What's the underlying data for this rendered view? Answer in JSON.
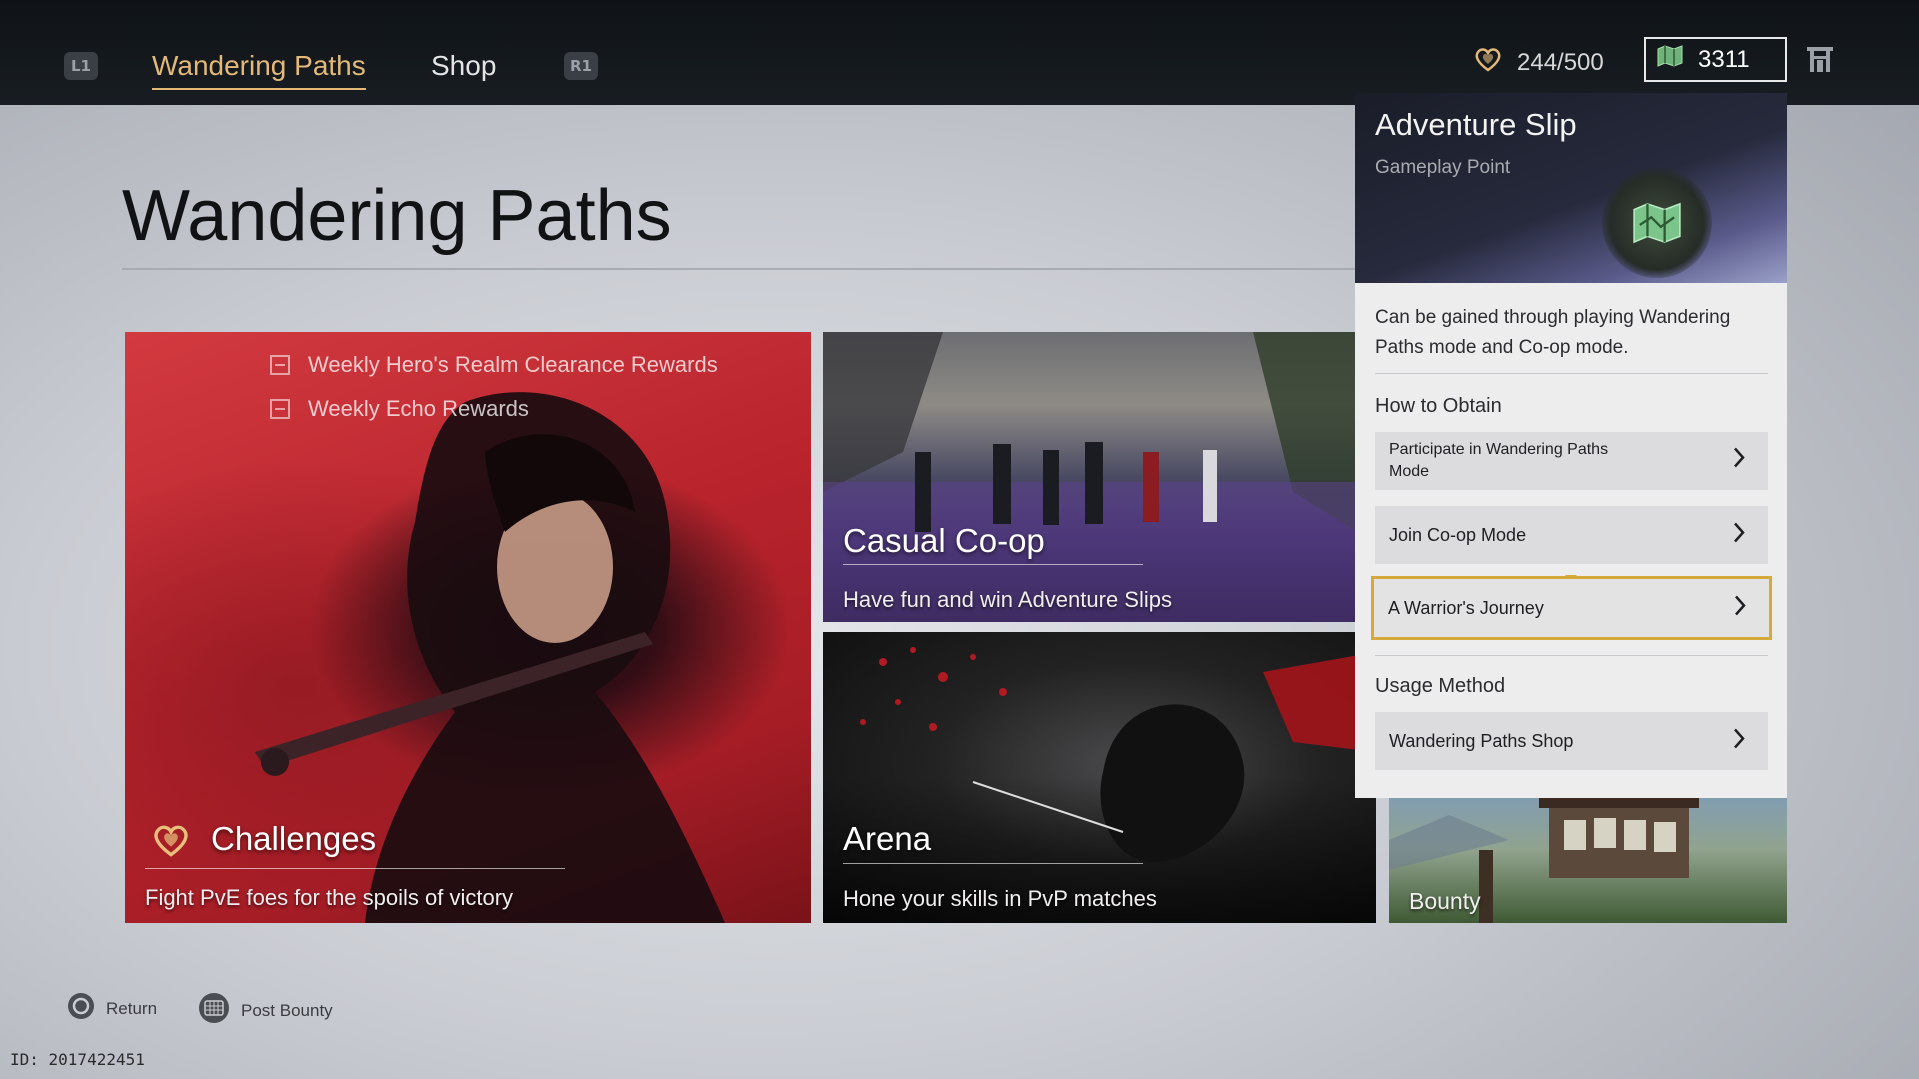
{
  "topbar": {
    "l1_hint": "L1",
    "r1_hint": "R1",
    "tabs": [
      {
        "label": "Wandering Paths",
        "active": true
      },
      {
        "label": "Shop",
        "active": false
      }
    ],
    "stamina": "244/500",
    "adventure_slips": "3311",
    "accent_color": "#e3b979"
  },
  "page": {
    "title": "Wandering Paths"
  },
  "cards": {
    "challenges": {
      "weekly_items": [
        "Weekly Hero's Realm Clearance Rewards",
        "Weekly Echo Rewards"
      ],
      "label": "Challenges",
      "desc": "Fight PvE foes for the spoils of victory"
    },
    "casual_coop": {
      "label": "Casual Co-op",
      "desc": "Have fun and win Adventure Slips"
    },
    "arena": {
      "label": "Arena",
      "desc": "Hone your skills in PvP matches"
    },
    "bounty": {
      "label": "Bounty"
    }
  },
  "tooltip": {
    "title": "Adventure Slip",
    "subtitle": "Gameplay Point",
    "description": "Can be gained through playing Wandering Paths mode and Co-op mode.",
    "how_to_obtain_label": "How to Obtain",
    "obtain_options": [
      "Participate in Wandering Paths Mode",
      "Join Co-op Mode",
      "A Warrior's Journey"
    ],
    "usage_label": "Usage Method",
    "usage_options": [
      "Wandering Paths Shop"
    ],
    "selected_color": "#d7a93a"
  },
  "footer": {
    "return_label": "Return",
    "post_bounty_label": "Post Bounty",
    "id_text": "ID: 2017422451"
  }
}
